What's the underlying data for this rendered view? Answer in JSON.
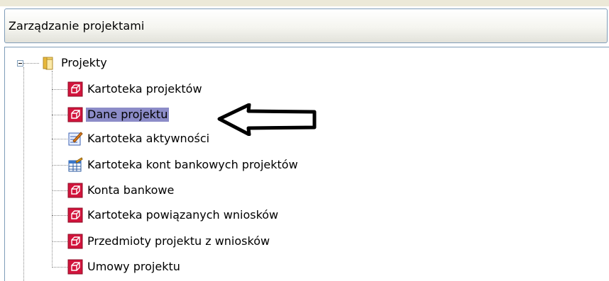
{
  "window": {
    "title": "Zarządzanie projektami"
  },
  "tree": {
    "root": {
      "label": "Projekty",
      "icon": "folder-icon",
      "expanded": true
    },
    "children": [
      {
        "label": "Kartoteka projektów",
        "icon": "red-cube-icon"
      },
      {
        "label": "Dane projektu",
        "icon": "red-cube-icon",
        "selected": true
      },
      {
        "label": "Kartoteka aktywności",
        "icon": "checklist-icon"
      },
      {
        "label": "Kartoteka kont bankowych projektów",
        "icon": "spreadsheet-icon"
      },
      {
        "label": "Konta bankowe",
        "icon": "red-cube-icon"
      },
      {
        "label": "Kartoteka powiązanych wniosków",
        "icon": "red-cube-icon"
      },
      {
        "label": "Przedmioty projektu z wniosków",
        "icon": "red-cube-icon"
      },
      {
        "label": "Umowy projektu",
        "icon": "red-cube-icon"
      }
    ]
  },
  "annotation": {
    "icon": "pointer-arrow-icon",
    "colors": {
      "stroke": "#000000",
      "fill": "#ffffff"
    }
  },
  "colors": {
    "selection": "#8c8cc8",
    "border": "#7f9db9",
    "cube": "#d2143c"
  }
}
